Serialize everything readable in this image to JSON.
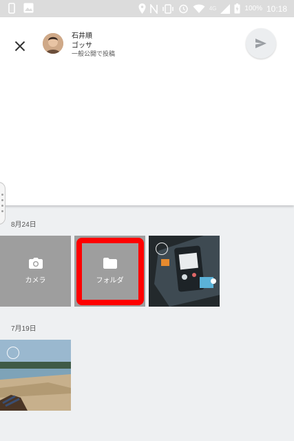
{
  "status_bar": {
    "battery": "100%",
    "time": "10:18",
    "network": "4G",
    "icons": [
      "phone-icon",
      "image-icon",
      "location-icon",
      "nfc-icon",
      "vibrate-icon",
      "alarm-icon",
      "wifi-icon",
      "signal-icon",
      "battery-icon"
    ]
  },
  "compose": {
    "close_icon": "close-icon",
    "user_name": "石井順",
    "page_name": "ゴッサ",
    "visibility": "一般公開で投稿",
    "send_icon": "send-icon"
  },
  "gallery": {
    "sections": [
      {
        "date": "8月24日"
      },
      {
        "date": "7月19日"
      }
    ],
    "camera_label": "カメラ",
    "folder_label": "フォルダ",
    "highlight_color": "#ff0000"
  }
}
